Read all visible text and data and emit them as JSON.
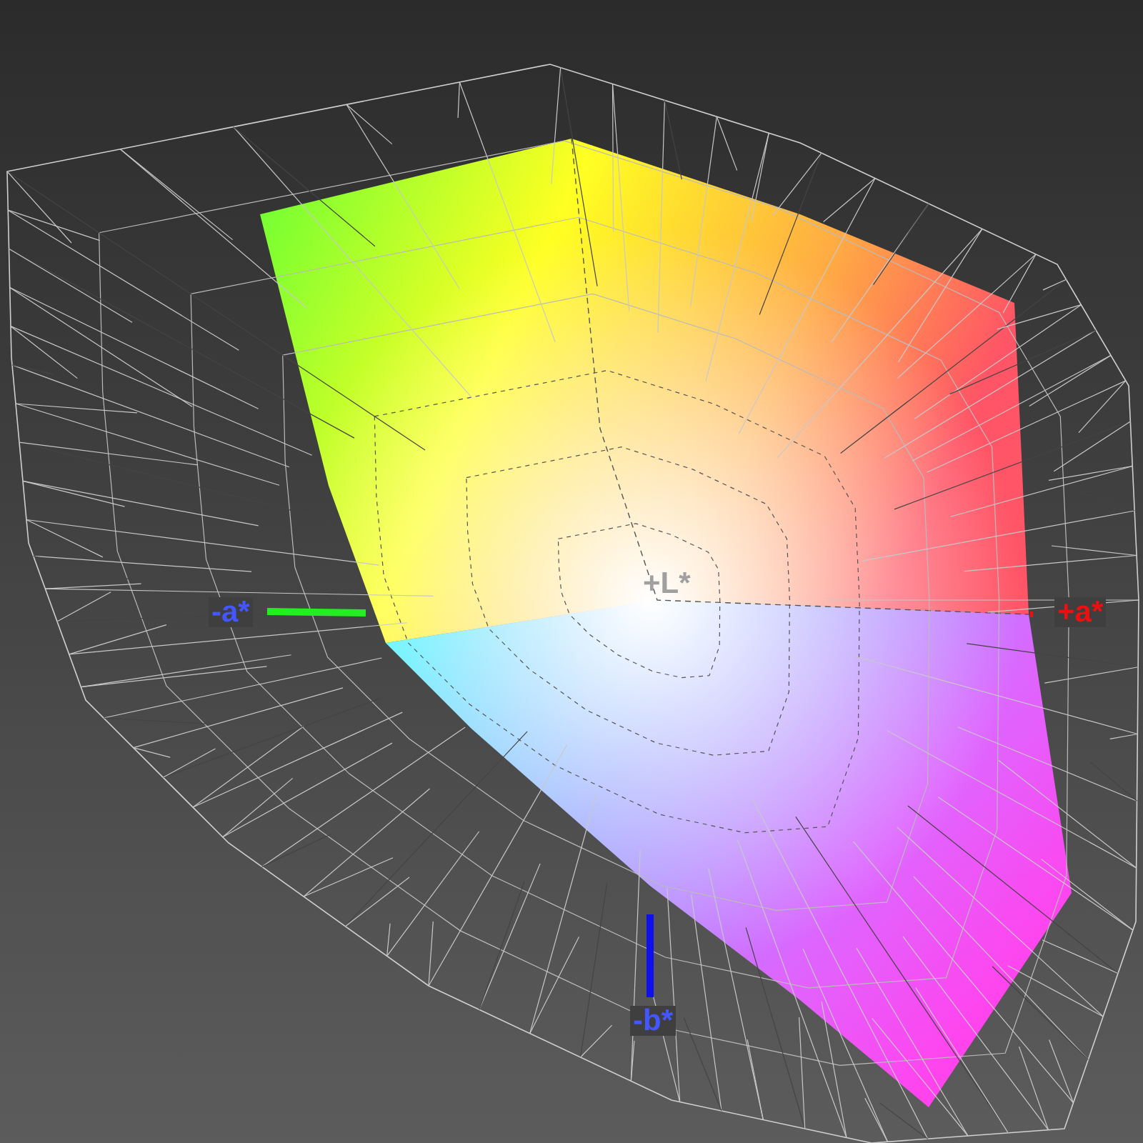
{
  "axes": [
    {
      "label": "+L*",
      "kind": "up",
      "color": "#a0a0a0"
    },
    {
      "label": "-a*",
      "kind": "left",
      "color": "#4456ff"
    },
    {
      "label": "+a*",
      "kind": "right",
      "color": "#ee1010"
    },
    {
      "label": "-b*",
      "kind": "down",
      "color": "#4456ff"
    }
  ]
}
